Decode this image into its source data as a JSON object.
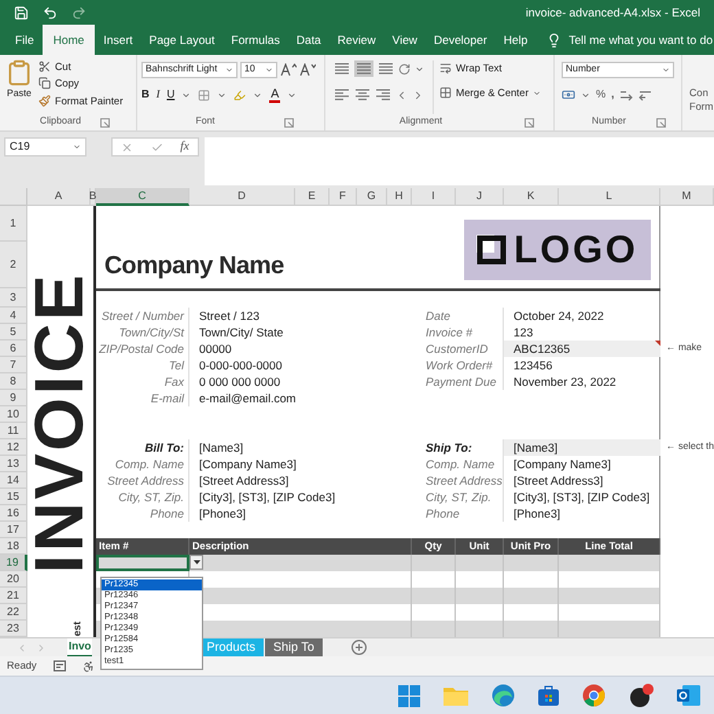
{
  "window": {
    "title": "invoice- advanced-A4.xlsx - Excel"
  },
  "ribbon_tabs": [
    {
      "label": "File",
      "selected": false
    },
    {
      "label": "Home",
      "selected": true
    },
    {
      "label": "Insert",
      "selected": false
    },
    {
      "label": "Page Layout",
      "selected": false
    },
    {
      "label": "Formulas",
      "selected": false
    },
    {
      "label": "Data",
      "selected": false
    },
    {
      "label": "Review",
      "selected": false
    },
    {
      "label": "View",
      "selected": false
    },
    {
      "label": "Developer",
      "selected": false
    },
    {
      "label": "Help",
      "selected": false
    }
  ],
  "tell_me": "Tell me what you want to do",
  "ribbon": {
    "clipboard": {
      "label": "Clipboard",
      "paste": "Paste",
      "cut": "Cut",
      "copy": "Copy",
      "format_painter": "Format Painter"
    },
    "font": {
      "label": "Font",
      "font_name": "Bahnschrift Light",
      "font_size": "10",
      "bold": "B",
      "italic": "I",
      "underline": "U",
      "font_color": "A"
    },
    "alignment": {
      "label": "Alignment",
      "wrap_text": "Wrap Text",
      "merge_center": "Merge & Center"
    },
    "number": {
      "label": "Number",
      "format": "Number",
      "percent": "%",
      "comma": ","
    },
    "conditional_formatting": {
      "lines": [
        "Con",
        "Form"
      ]
    }
  },
  "formula_bar": {
    "name_box": "C19",
    "function_label": "fx"
  },
  "columns": [
    {
      "label": "A",
      "selected": false
    },
    {
      "label": "B",
      "selected": false
    },
    {
      "label": "C",
      "selected": true
    },
    {
      "label": "D",
      "selected": false
    },
    {
      "label": "E",
      "selected": false
    },
    {
      "label": "F",
      "selected": false
    },
    {
      "label": "G",
      "selected": false
    },
    {
      "label": "H",
      "selected": false
    },
    {
      "label": "I",
      "selected": false
    },
    {
      "label": "J",
      "selected": false
    },
    {
      "label": "K",
      "selected": false
    },
    {
      "label": "L",
      "selected": false
    },
    {
      "label": "M",
      "selected": false
    }
  ],
  "rows": [
    {
      "label": "1",
      "selected": false
    },
    {
      "label": "2",
      "selected": false
    },
    {
      "label": "3",
      "selected": false
    },
    {
      "label": "4",
      "selected": false
    },
    {
      "label": "5",
      "selected": false
    },
    {
      "label": "6",
      "selected": false
    },
    {
      "label": "7",
      "selected": false
    },
    {
      "label": "8",
      "selected": false
    },
    {
      "label": "9",
      "selected": false
    },
    {
      "label": "10",
      "selected": false
    },
    {
      "label": "11",
      "selected": false
    },
    {
      "label": "12",
      "selected": false
    },
    {
      "label": "13",
      "selected": false
    },
    {
      "label": "14",
      "selected": false
    },
    {
      "label": "15",
      "selected": false
    },
    {
      "label": "16",
      "selected": false
    },
    {
      "label": "17",
      "selected": false
    },
    {
      "label": "18",
      "selected": false
    },
    {
      "label": "19",
      "selected": true
    },
    {
      "label": "20",
      "selected": false
    },
    {
      "label": "21",
      "selected": false
    },
    {
      "label": "22",
      "selected": false
    },
    {
      "label": "23",
      "selected": false
    }
  ],
  "invoice": {
    "side_title": "INVOICE",
    "side_note": "est",
    "company_name": "Company Name",
    "logo": "LOGO",
    "company_fields": [
      {
        "label": "Street / Number",
        "value": "Street / 123"
      },
      {
        "label": "Town/City/St",
        "value": "Town/City/ State"
      },
      {
        "label": "ZIP/Postal Code",
        "value": "00000"
      },
      {
        "label": "Tel",
        "value": "0-000-000-0000"
      },
      {
        "label": "Fax",
        "value": "0 000 000 0000"
      },
      {
        "label": "E-mail",
        "value": "e-mail@email.com"
      }
    ],
    "invoice_fields": [
      {
        "label": "Date",
        "value": "October 24, 2022",
        "highlighted": false,
        "comment": false
      },
      {
        "label": "Invoice #",
        "value": "123",
        "highlighted": false,
        "comment": false
      },
      {
        "label": "CustomerID",
        "value": "ABC12365",
        "highlighted": true,
        "comment": true
      },
      {
        "label": "Work Order#",
        "value": "123456",
        "highlighted": false,
        "comment": false
      },
      {
        "label": "Payment Due",
        "value": "November 23, 2022",
        "highlighted": false,
        "comment": false
      }
    ],
    "bill_to": [
      {
        "label": "Bill To:",
        "value": "[Name3]",
        "highlighted": false
      },
      {
        "label": "Comp. Name",
        "value": "[Company Name3]",
        "highlighted": false
      },
      {
        "label": "Street Address",
        "value": "[Street Address3]",
        "highlighted": false
      },
      {
        "label": "City, ST, Zip.",
        "value": "[City3], [ST3], [ZIP Code3]",
        "highlighted": false
      },
      {
        "label": "Phone",
        "value": "[Phone3]",
        "highlighted": false
      }
    ],
    "ship_to": [
      {
        "label": "Ship To:",
        "value": "[Name3]",
        "highlighted": true
      },
      {
        "label": "Comp. Name",
        "value": "[Company Name3]",
        "highlighted": false
      },
      {
        "label": "Street Address",
        "value": "[Street Address3]",
        "highlighted": false
      },
      {
        "label": "City, ST, Zip.",
        "value": "[City3], [ST3], [ZIP Code3]",
        "highlighted": false
      },
      {
        "label": "Phone",
        "value": "[Phone3]",
        "highlighted": false
      }
    ],
    "notes": [
      "← make",
      "← select th"
    ],
    "table_columns": [
      "Item #",
      "Description",
      "Qty",
      "Unit",
      "Unit Pro",
      "Line Total"
    ]
  },
  "dropdown": [
    {
      "label": "Pr12345",
      "selected": true
    },
    {
      "label": "Pr12346",
      "selected": false
    },
    {
      "label": "Pr12347",
      "selected": false
    },
    {
      "label": "Pr12348",
      "selected": false
    },
    {
      "label": "Pr12349",
      "selected": false
    },
    {
      "label": "Pr12584",
      "selected": false
    },
    {
      "label": "Pr1235",
      "selected": false
    },
    {
      "label": "test1",
      "selected": false
    }
  ],
  "sheet_tabs": [
    {
      "label": "Invo",
      "selected": true,
      "color": "#ffffff"
    },
    {
      "label": "Products",
      "selected": false,
      "color": "#1cb4e4"
    },
    {
      "label": "Ship To",
      "selected": false,
      "color": "#6b6b6b"
    }
  ],
  "status_bar": {
    "ready": "Ready"
  }
}
